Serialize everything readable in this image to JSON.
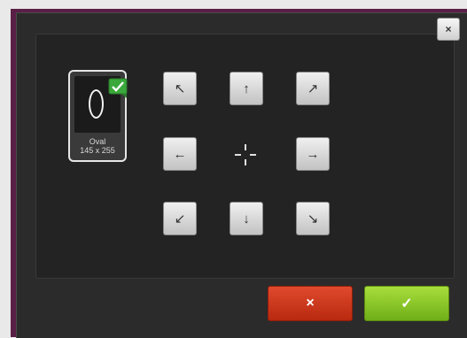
{
  "dialog": {
    "close_label": "×",
    "close_icon": "close-icon"
  },
  "hoop": {
    "name": "Oval",
    "size": "145 x 255",
    "selected": true,
    "icon": "oval-hoop-icon",
    "check_color": "#3aa83a"
  },
  "arrows": {
    "up_left": "↖",
    "up": "↑",
    "up_right": "↗",
    "left": "←",
    "right": "→",
    "down_left": "↙",
    "down": "↓",
    "down_right": "↘"
  },
  "center_icon": "center-target-icon",
  "actions": {
    "cancel_label": "×",
    "confirm_label": "✓",
    "cancel_color": "#c83a1f",
    "confirm_color": "#8cc62a"
  }
}
